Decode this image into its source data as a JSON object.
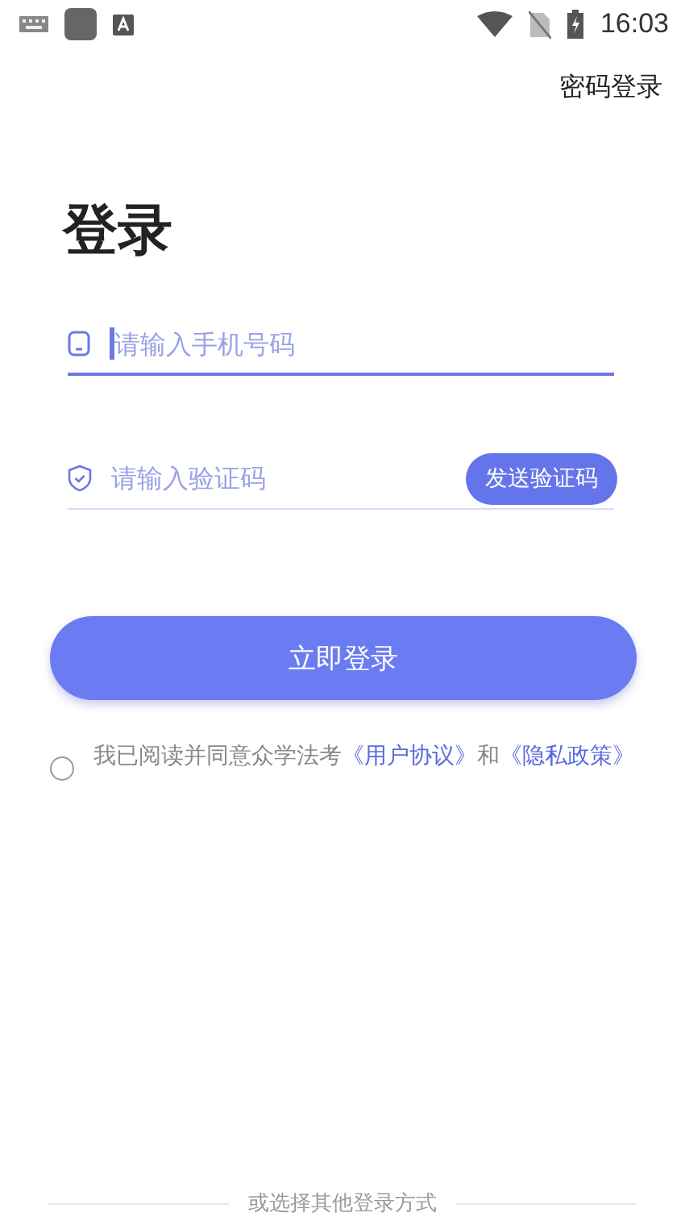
{
  "status_bar": {
    "time": "16:03"
  },
  "header": {
    "link": "密码登录"
  },
  "title": "登录",
  "fields": [
    {
      "kind": "phone",
      "placeholder": "请输入手机号码",
      "focused": true
    },
    {
      "kind": "code",
      "placeholder": "请输入验证码",
      "focused": false,
      "button": "发送验证码"
    }
  ],
  "login_button": "立即登录",
  "agreement": {
    "checked": false,
    "parts": [
      {
        "text": "我已阅读并同意众学法考",
        "link": false
      },
      {
        "text": "《用户协议》",
        "link": true
      },
      {
        "text": "和",
        "link": false
      },
      {
        "text": "《隐私政策》",
        "link": true
      }
    ]
  },
  "footer": {
    "divider_text": "或选择其他登录方式"
  }
}
